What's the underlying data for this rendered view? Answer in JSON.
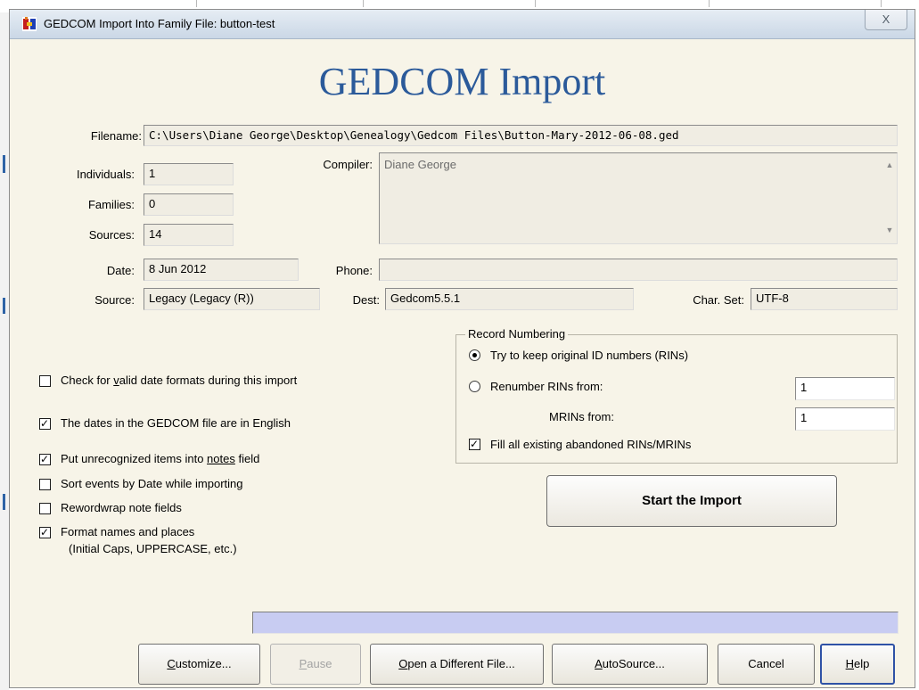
{
  "window": {
    "title": "GEDCOM Import Into Family File: button-test",
    "close_label": "X"
  },
  "header": {
    "title": "GEDCOM Import"
  },
  "file": {
    "filename_label": "Filename:",
    "filename": "C:\\Users\\Diane George\\Desktop\\Genealogy\\Gedcom Files\\Button-Mary-2012-06-08.ged"
  },
  "stats": {
    "individuals_label": "Individuals:",
    "individuals": "1",
    "families_label": "Families:",
    "families": "0",
    "sources_label": "Sources:",
    "sources": "14",
    "date_label": "Date:",
    "date": "8 Jun 2012",
    "source_label": "Source:",
    "source": "Legacy (Legacy (R))"
  },
  "compiler": {
    "label": "Compiler:",
    "value": "Diane George",
    "phone_label": "Phone:",
    "phone": "",
    "dest_label": "Dest:",
    "dest": "Gedcom5.5.1",
    "charset_label": "Char. Set:",
    "charset": "UTF-8"
  },
  "record_numbering": {
    "title": "Record Numbering",
    "keep_label": "Try to keep original ID numbers (RINs)",
    "renumber_label": "Renumber RINs from:",
    "rins_from": "1",
    "mrins_label": "MRINs from:",
    "mrins_from": "1",
    "fill_label": "Fill all existing abandoned RINs/MRINs"
  },
  "options": {
    "valid_date_pre": "Check for ",
    "valid_date_key": "v",
    "valid_date_post": "alid date formats during this import",
    "english_label": "The dates in the GEDCOM file are in English",
    "notes_pre": "Put unrecognized items into ",
    "notes_key": "notes",
    "notes_post": " field",
    "sort_label": "Sort events by Date while importing",
    "rewrap_label": "Rewordwrap note fields",
    "format_label": "Format names and places",
    "format_sub": "(Initial Caps, UPPERCASE, etc.)"
  },
  "start_label": "Start the Import",
  "buttons": {
    "customize_key": "C",
    "customize_rest": "ustomize...",
    "pause_key": "P",
    "pause_rest": "ause",
    "open_key": "O",
    "open_rest": "pen a Different File...",
    "autosource_key": "A",
    "autosource_rest": "utoSource...",
    "cancel": "Cancel",
    "help_key": "H",
    "help_rest": "elp"
  }
}
